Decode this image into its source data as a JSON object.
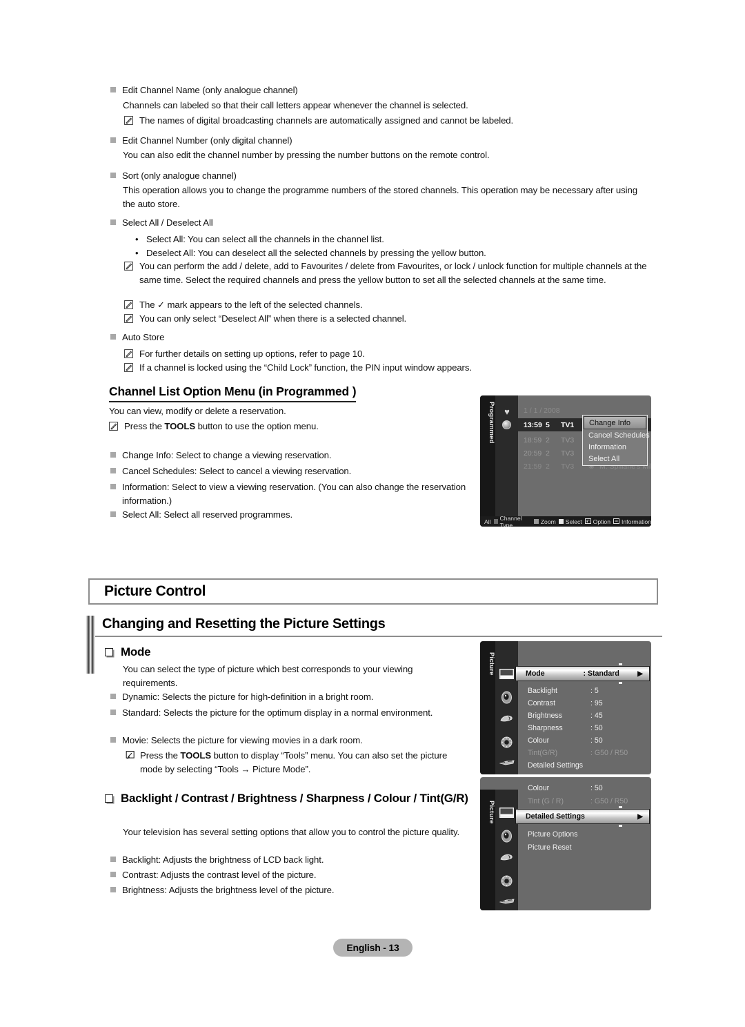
{
  "page": {
    "footer_label": "English - 13",
    "accent_gray": "#a8a8a8",
    "rule_gray": "#8e8e8e"
  },
  "channel_edit": {
    "items": [
      {
        "title": "Edit Channel Name (only analogue channel)",
        "body": "Channels can labeled so that their call letters appear whenever the channel is selected.",
        "notes": [
          "The names of digital broadcasting channels are automatically assigned and cannot be labeled."
        ]
      },
      {
        "title": "Edit Channel Number (only digital channel)",
        "body": "You can also edit the channel number by pressing the number buttons on the remote control.",
        "notes": []
      },
      {
        "title": "Sort (only analogue channel)",
        "body": "This operation allows you to change the programme numbers of the stored channels. This operation may be necessary after using the auto store.",
        "notes": []
      }
    ],
    "select_all": {
      "title": "Select All / Deselect All",
      "bullets": [
        "Select All: You can select all the channels in the channel list.",
        "Deselect All: You can deselect all the selected channels by pressing the yellow button."
      ],
      "notes": [
        "You can perform the add / delete, add to Favourites / delete from Favourites, or lock / unlock function for multiple channels at the same time. Select the required channels and press the yellow button to set all the selected channels at the same time.",
        "The ✓ mark appears to the left of the selected channels.",
        "You can only select “Deselect All” when there is a selected channel."
      ]
    },
    "auto_store": {
      "title": "Auto Store",
      "notes": [
        "For further details on setting up options, refer to page 10.",
        "If a channel is locked using the “Child Lock” function, the PIN input window appears."
      ]
    }
  },
  "option_menu": {
    "heading": "Channel List Option Menu (in Programmed )",
    "intro": "You can view, modify or delete a reservation.",
    "note": "Press the TOOLS button to use the option menu.",
    "note_prefix": "Press the ",
    "note_bold": "TOOLS",
    "note_suffix": " button to use the option menu.",
    "items": [
      "Change Info: Select to change a viewing reservation.",
      "Cancel Schedules: Select to cancel a viewing reservation.",
      "Information: Select to view a viewing reservation. (You can also change the reservation information.)",
      "Select All: Select all reserved programmes."
    ]
  },
  "osd_programmed": {
    "side_label": "Programmed",
    "date": "1 / 1 / 2008",
    "rows": [
      {
        "time": "13:59",
        "num": "5",
        "channel": "TV1",
        "title": "",
        "state": "selected"
      },
      {
        "time": "18:59",
        "num": "2",
        "channel": "TV3",
        "title": "",
        "state": "dim"
      },
      {
        "time": "20:59",
        "num": "2",
        "channel": "TV3",
        "title": "",
        "state": "dim"
      },
      {
        "time": "21:59",
        "num": "2",
        "channel": "TV3",
        "title": "M. Spillane's Mike Hammer",
        "state": "dim"
      }
    ],
    "popup": {
      "items": [
        "Change Info",
        "Cancel Schedules",
        "Information",
        "Select All"
      ],
      "selected_index": 0
    },
    "statusbar": [
      {
        "label": "All",
        "swatch": null
      },
      {
        "label": "Channel Type",
        "swatch": "#6e6e6e"
      },
      {
        "label": "Zoom",
        "swatch": "#9a9a9a"
      },
      {
        "label": "Select",
        "swatch": "#e8e8e8"
      },
      {
        "label": "Option",
        "swatch": "return-icon"
      },
      {
        "label": "Information",
        "swatch": "info-icon"
      }
    ]
  },
  "picture_control": {
    "section_title": "Picture Control",
    "subsection_title": "Changing and Resetting the Picture Settings",
    "mode": {
      "heading": "Mode",
      "intro": "You can select the type of picture which best corresponds to your viewing requirements.",
      "bullets": [
        "Dynamic: Selects the picture for high-definition in a bright room.",
        "Standard: Selects the picture for the optimum display in a normal environment.",
        "Movie: Selects the picture for viewing movies in a dark room."
      ],
      "tools_note_prefix": "Press the ",
      "tools_note_bold": "TOOLS",
      "tools_note_suffix": " button to display “Tools” menu. You can also set the picture mode by selecting “Tools → Picture Mode”."
    },
    "backlight": {
      "heading": "Backlight / Contrast / Brightness / Sharpness / Colour / Tint(G/R)",
      "intro": "Your television has several setting options that allow you to control the picture quality.",
      "bullets": [
        "Backlight: Adjusts the brightness of LCD back light.",
        "Contrast: Adjusts the contrast level of the picture.",
        "Brightness: Adjusts the brightness level of the picture."
      ]
    }
  },
  "osd_picture_1": {
    "side_label": "Picture",
    "rows": [
      {
        "label": "Mode",
        "value": ": Standard",
        "state": "highlight",
        "arrow": "▶"
      },
      {
        "label": "Backlight",
        "value": ": 5",
        "state": "normal"
      },
      {
        "label": "Contrast",
        "value": ": 95",
        "state": "normal"
      },
      {
        "label": "Brightness",
        "value": ": 45",
        "state": "normal"
      },
      {
        "label": "Sharpness",
        "value": ": 50",
        "state": "normal"
      },
      {
        "label": "Colour",
        "value": ": 50",
        "state": "normal"
      },
      {
        "label": "Tint(G/R)",
        "value": ": G50 / R50",
        "state": "dim"
      },
      {
        "label": "Detailed Settings",
        "value": "",
        "state": "normal"
      }
    ],
    "rail_icons": [
      "picture-icon",
      "sound-icon",
      "channel-icon",
      "setup-icon",
      "input-icon",
      "support-icon"
    ]
  },
  "osd_picture_2": {
    "side_label": "Picture",
    "rows": [
      {
        "label": "Colour",
        "value": ": 50",
        "state": "normal"
      },
      {
        "label": "Tint (G / R)",
        "value": ": G50 / R50",
        "state": "dim"
      },
      {
        "label": "Detailed Settings",
        "value": "",
        "state": "highlight",
        "arrow": "▶"
      },
      {
        "label": "Picture Options",
        "value": "",
        "state": "normal"
      },
      {
        "label": "Picture Reset",
        "value": "",
        "state": "normal"
      }
    ],
    "rail_icons": [
      "picture-icon",
      "sound-icon",
      "channel-icon",
      "setup-icon",
      "input-icon",
      "support-icon"
    ]
  }
}
